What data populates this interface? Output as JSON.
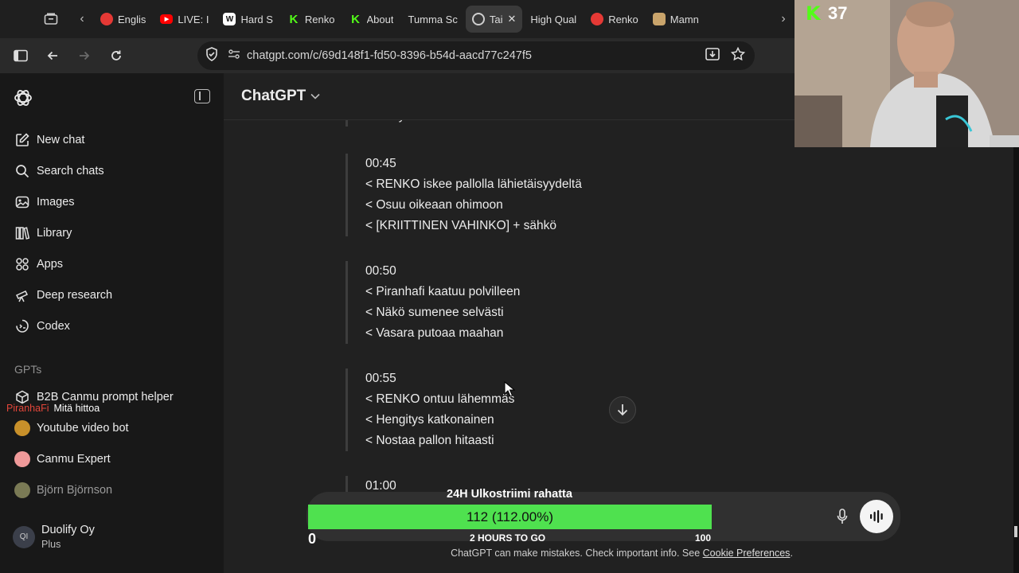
{
  "browser": {
    "tabs": [
      {
        "title": "Englis",
        "favicon": "english-favicon",
        "color": "#e53935"
      },
      {
        "title": "LIVE: I",
        "favicon": "youtube-favicon",
        "color": "#ff0000"
      },
      {
        "title": "Hard S",
        "favicon": "w-favicon",
        "color": "#ffffff"
      },
      {
        "title": "Renko",
        "favicon": "kick-favicon",
        "color": "#53fc18"
      },
      {
        "title": "About",
        "favicon": "kick-favicon",
        "color": "#53fc18"
      },
      {
        "title": "Tumma Sc",
        "favicon": "",
        "color": ""
      },
      {
        "title": "Tai",
        "favicon": "chatgpt-favicon",
        "color": "#cfcfcf",
        "active": true
      },
      {
        "title": "High Qual",
        "favicon": "",
        "color": ""
      },
      {
        "title": "Renko",
        "favicon": "renko-favicon",
        "color": "#e53935"
      },
      {
        "title": "Mamn",
        "favicon": "image-favicon",
        "color": "#c9a46b"
      }
    ],
    "url": "chatgpt.com/c/69d148f1-fd50-8396-b54d-aacd77c247f5"
  },
  "sidebar": {
    "items": [
      {
        "label": "New chat",
        "icon": "pencil-square-icon"
      },
      {
        "label": "Search chats",
        "icon": "search-icon"
      },
      {
        "label": "Images",
        "icon": "images-icon"
      },
      {
        "label": "Library",
        "icon": "library-icon"
      },
      {
        "label": "Apps",
        "icon": "apps-icon"
      },
      {
        "label": "Deep research",
        "icon": "telescope-icon"
      },
      {
        "label": "Codex",
        "icon": "codex-icon"
      }
    ],
    "gpts_heading": "GPTs",
    "gpts": [
      {
        "label": "B2B Canmu prompt helper",
        "icon": "cube-icon"
      },
      {
        "label": "Youtube video bot",
        "icon": "avatar-yt",
        "color": "#c8902a"
      },
      {
        "label": "Canmu Expert",
        "icon": "avatar-canmu",
        "color": "#f09a9a"
      },
      {
        "label": "Björn Björnson",
        "icon": "avatar-bjorn",
        "color": "#7a7a55"
      }
    ],
    "account": {
      "initials": "QI",
      "name": "Duolify Oy",
      "plan": "Plus"
    }
  },
  "stream_chat": {
    "user": "PiranhaFi",
    "message": "Mitä hittoa"
  },
  "main": {
    "model_label": "ChatGPT",
    "conversation": [
      {
        "time": "",
        "lines": [
          "< Siili yrittää vastata"
        ]
      },
      {
        "time": "00:45",
        "lines": [
          "< RENKO iskee pallolla lähietäisyydeltä",
          "< Osuu oikeaan ohimoon",
          "< [KRIITTINEN VAHINKO] + sähkö"
        ]
      },
      {
        "time": "00:50",
        "lines": [
          "< Piranhafi kaatuu polvilleen",
          "< Näkö sumenee selvästi",
          "< Vasara putoaa maahan"
        ]
      },
      {
        "time": "00:55",
        "lines": [
          "< RENKO ontuu lähemmäs",
          "< Hengitys katkonainen",
          "< Nostaa pallon hitaasti"
        ]
      },
      {
        "time": "01:00",
        "lines": []
      }
    ],
    "disclaimer": "ChatGPT can make mistakes. Check important info. See ",
    "disclaimer_link": "Cookie Preferences",
    "disclaimer_end": "."
  },
  "goal": {
    "title": "24H Ulkostriimi rahatta",
    "value_label": "112 (112.00%)",
    "progress": 1.12,
    "min_label": "0",
    "time_left": "2 HOURS TO GO",
    "max_label": "100",
    "bar_color": "#4fe14f"
  },
  "webcam": {
    "viewer_count": "37",
    "icon": "kick-icon"
  }
}
